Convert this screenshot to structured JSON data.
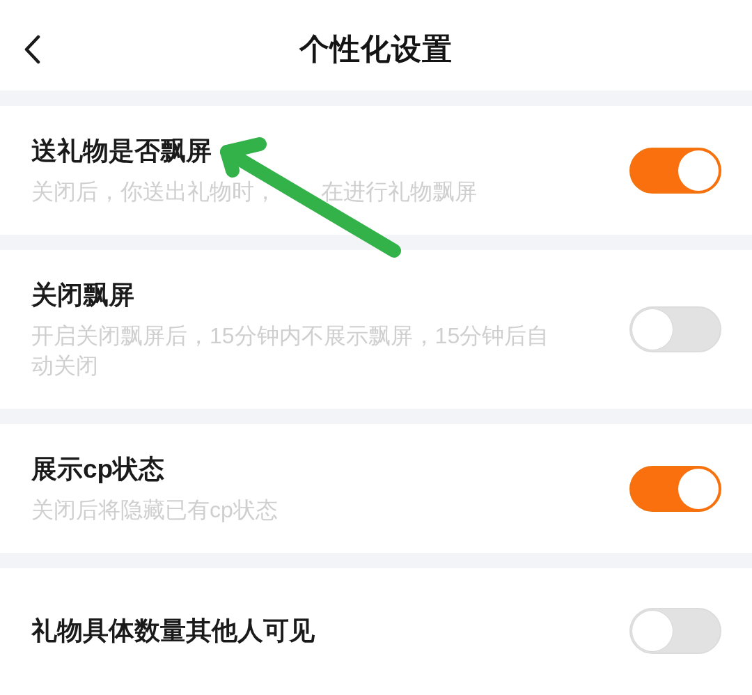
{
  "header": {
    "title": "个性化设置"
  },
  "settings": [
    {
      "title": "送礼物是否飘屏",
      "description": [
        "关闭后，你送出礼物时，",
        "在进行礼物飘屏"
      ],
      "on": true
    },
    {
      "title": "关闭飘屏",
      "description": [
        "开启关闭飘屏后，15分钟内不展示飘屏，15分钟后自动关闭"
      ],
      "on": false
    },
    {
      "title": "展示cp状态",
      "description": [
        "关闭后将隐藏已有cp状态"
      ],
      "on": true
    },
    {
      "title": "礼物具体数量其他人可见",
      "on": false
    }
  ]
}
